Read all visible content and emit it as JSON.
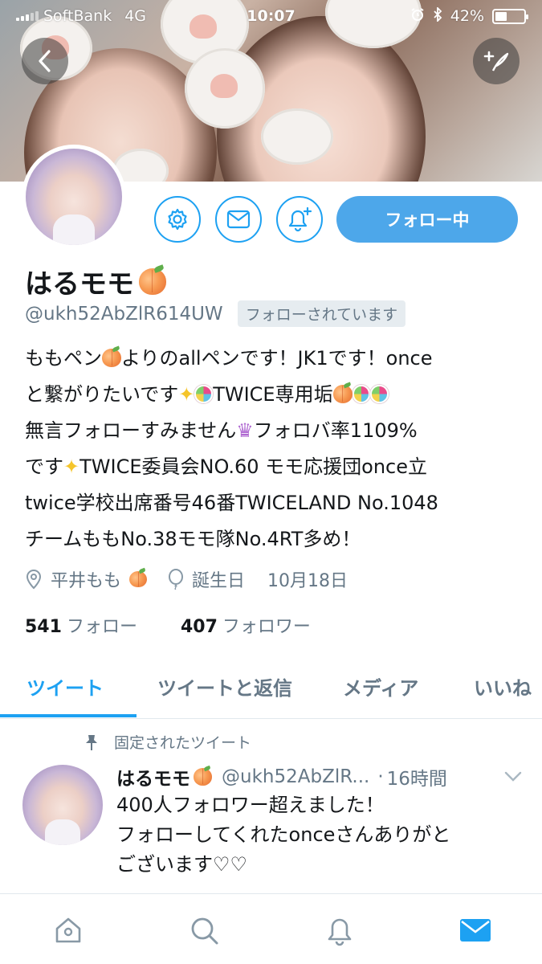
{
  "status_bar": {
    "carrier": "SoftBank",
    "network": "4G",
    "time": "10:07",
    "battery": "42%",
    "battery_level": 0.42
  },
  "header": {
    "back_icon": "chevron-left-icon",
    "compose_icon": "compose-tweet-icon"
  },
  "actions": {
    "follow_label": "フォロー中",
    "settings_icon": "gear-icon",
    "message_icon": "envelope-icon",
    "notify_icon": "bell-plus-icon"
  },
  "profile": {
    "name": "はるモモ",
    "handle": "@ukh52AbZlR614UW",
    "follows_you": "フォローされています",
    "bio": {
      "l1a": "ももペン",
      "l1b": "よりのallペンです！JK1です！once",
      "l2a": "と繋がりたいです",
      "l2b": "TWICE専用垢",
      "l3a": "無言フォローすみません",
      "l3b": "フォロバ率1109%",
      "l4a": "です",
      "l4b": "TWICE委員会NO.60 モモ応援団once立",
      "l5": "twice学校出席番号46番TWICELAND No.1048",
      "l6": "チームももNo.38モモ隊No.4RT多め！"
    },
    "location": "平井もも",
    "birthday_label": "誕生日",
    "birthday": "10月18日",
    "following_count": "541",
    "following_label": "フォロー",
    "followers_count": "407",
    "followers_label": "フォロワー"
  },
  "tabs": [
    {
      "label": "ツイート",
      "active": true
    },
    {
      "label": "ツイートと返信",
      "active": false
    },
    {
      "label": "メディア",
      "active": false
    },
    {
      "label": "いいね",
      "active": false
    }
  ],
  "tweet": {
    "pinned_label": "固定されたツイート",
    "name": "はるモモ",
    "handle": "@ukh52AbZlR...",
    "separator": "·",
    "time": "16時間",
    "text_l1": "400人フォロワー超えました！",
    "text_l2": "フォローしてくれたonceさんありがと",
    "text_l3": "ございます♡♡"
  },
  "bottom_nav": [
    "home-icon",
    "search-icon",
    "bell-icon",
    "envelope-icon"
  ],
  "colors": {
    "accent": "#1da1f2",
    "follow_button": "#4da7ea",
    "secondary_text": "#657786"
  }
}
